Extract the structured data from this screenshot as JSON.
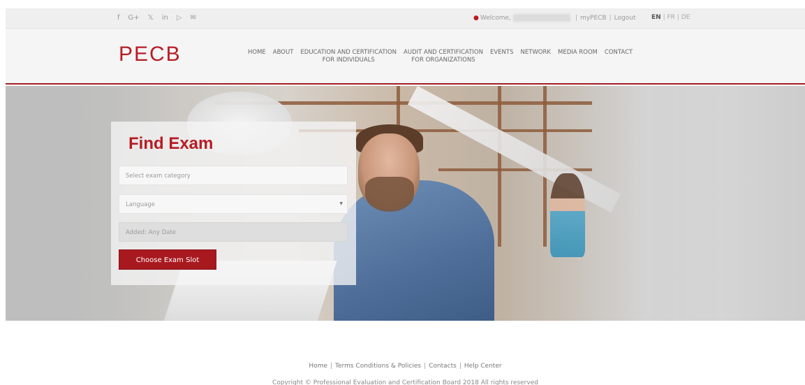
{
  "topbar": {
    "social_icons": [
      "f",
      "G+",
      "t",
      "in",
      "yt",
      "mail"
    ],
    "social_names": [
      "facebook-icon",
      "google-plus-icon",
      "twitter-icon",
      "linkedin-icon",
      "youtube-icon",
      "mail-icon"
    ],
    "welcome": "Welcome,",
    "mypecb": "myPECB",
    "logout": "Logout",
    "sep": "|",
    "languages": {
      "en": "EN",
      "fr": "FR",
      "de": "DE"
    }
  },
  "header": {
    "logo": "PECB",
    "nav": [
      "HOME",
      "ABOUT",
      "EDUCATION AND CERTIFICATION\nFOR INDIVIDUALS",
      "AUDIT AND CERTIFICATION\nFOR ORGANIZATIONS",
      "EVENTS",
      "NETWORK",
      "MEDIA ROOM",
      "CONTACT"
    ]
  },
  "find_exam": {
    "title": "Find Exam",
    "category_placeholder": "Select exam category",
    "language_placeholder": "Language",
    "added_placeholder": "Added: Any Date",
    "button": "Choose Exam Slot"
  },
  "footer": {
    "links": [
      "Home",
      "Terms Conditions & Policies",
      "Contacts",
      "Help Center"
    ],
    "copyright": "Copyright © Professional Evaluation and Certification Board 2018 All rights reserved"
  },
  "colors": {
    "brand_red": "#b71c24",
    "button_red": "#a8191f"
  }
}
